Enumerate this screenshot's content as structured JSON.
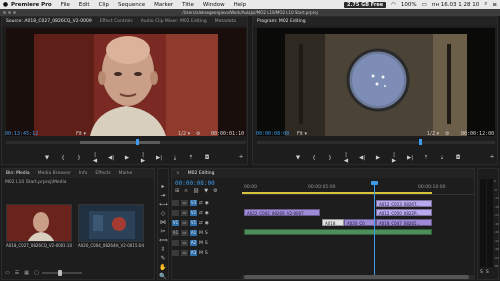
{
  "menubar": {
    "apple": "",
    "items": [
      "Premiere Pro",
      "File",
      "Edit",
      "Clip",
      "Sequence",
      "Marker",
      "Title",
      "Window",
      "Help"
    ],
    "free_space": "2.75 GB Free",
    "battery": "100%",
    "clock": "пн 16.03  1 28 10"
  },
  "title_bar": {
    "path": "/Users/aleksegeorgievo/Work/AulaJul/MO2 L10/MO2 L10 Start.prproj"
  },
  "source_monitor": {
    "tabs": [
      "Source: A018_C027_0826CQ_V2-0009",
      "Effect Controls",
      "Audio Clip Mixer: M02 Editing",
      "Metadata"
    ],
    "timecode": "00:13:45:12",
    "fit": "Fit",
    "resolution": "1/2",
    "duration": "00:00:01:10"
  },
  "program_monitor": {
    "tab": "Program: M02 Editing",
    "timecode": "00:00:08:00",
    "fit": "Fit",
    "resolution": "1/2",
    "duration": "00:00:12:00"
  },
  "project_panel": {
    "tabs": [
      "Bin: Media",
      "Media Browser",
      "Info",
      "Effects",
      "Marke"
    ],
    "path": "M02 L10 Start.prproj\\Media",
    "items": [
      {
        "name": "A018_C027_0826CQ_V2-0009",
        "duration": "1:10"
      },
      {
        "name": "A020_C004_08264H_V2-0017",
        "duration": "5:04"
      }
    ]
  },
  "timeline": {
    "tab": "M02 Editing",
    "timecode": "00:00:08:00",
    "ruler": [
      "00:00",
      "00:00:05:00",
      "00:00:10:00"
    ],
    "tracks": [
      {
        "id": "V3",
        "label": "V3"
      },
      {
        "id": "V2",
        "label": "V2"
      },
      {
        "id": "V1",
        "label": "V1"
      },
      {
        "id": "A1",
        "label": "A1"
      },
      {
        "id": "A2",
        "label": "A2"
      },
      {
        "id": "A3",
        "label": "A3"
      }
    ],
    "clips": {
      "v3_a": "A012_C013_0826T...",
      "v2_b": "A012_C050_0822P...",
      "v1_c": "A022_C002_0826R_V2-0007",
      "v1_d": "A018",
      "v1_e": "A020_C0",
      "v1_f": "A018_C047_08265..."
    }
  },
  "audio_meter": {
    "labels": [
      "0",
      "-6",
      "-12",
      "-18",
      "-24",
      "-30",
      "-36",
      "-42",
      "-48",
      "-54",
      "dB"
    ],
    "solo": "S",
    "solo2": "S"
  },
  "colors": {
    "timecode_blue": "#3d9be9",
    "video_clip": "#9e8ad6",
    "audio_clip": "#4d8f5a",
    "accent": "#2d6ea8"
  },
  "icons": {
    "wrench": "🔧",
    "plus": "+",
    "marker": "▼",
    "in": "{",
    "out": "}",
    "prev": "|◀",
    "step_back": "◀|",
    "play": "▶",
    "step_fwd": "|▶",
    "next": "▶|",
    "insert": "⤓",
    "overwrite": "⤒",
    "export": "◘",
    "lift": "⇡",
    "extract": "⇣"
  },
  "tools": [
    "▸",
    "⇥",
    "⟷",
    "◇",
    "⋈",
    "✂",
    "⟺",
    "⇳",
    "✎",
    "✋",
    "🔍"
  ]
}
